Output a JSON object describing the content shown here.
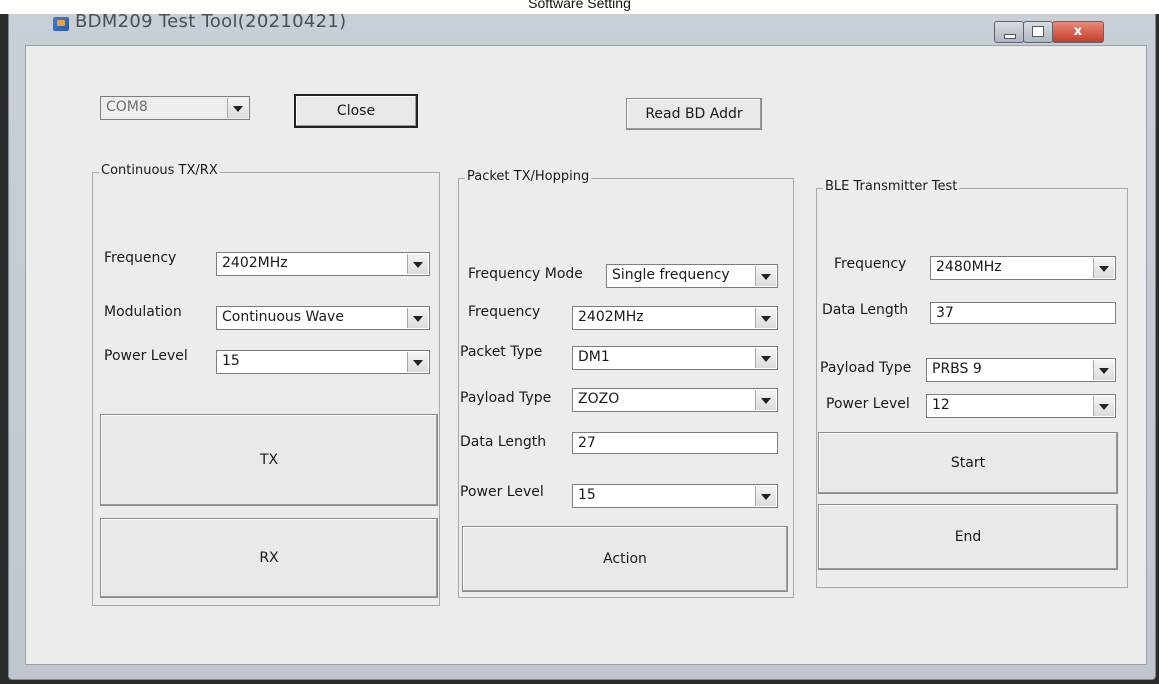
{
  "caption": "Software Setting",
  "window": {
    "title": "BDM209 Test Tool(20210421)",
    "close_glyph": "x"
  },
  "top": {
    "port": "COM8",
    "close_label": "Close",
    "read_addr_label": "Read BD Addr"
  },
  "continuous": {
    "title": "Continuous TX/RX",
    "frequency_label": "Frequency",
    "frequency_value": "2402MHz",
    "modulation_label": "Modulation",
    "modulation_value": "Continuous Wave",
    "power_label": "Power Level",
    "power_value": "15",
    "tx_label": "TX",
    "rx_label": "RX"
  },
  "packet": {
    "title": "Packet TX/Hopping",
    "freq_mode_label": "Frequency Mode",
    "freq_mode_value": "Single frequency",
    "frequency_label": "Frequency",
    "frequency_value": "2402MHz",
    "packet_type_label": "Packet Type",
    "packet_type_value": "DM1",
    "payload_type_label": "Payload Type",
    "payload_type_value": "ZOZO",
    "data_length_label": "Data Length",
    "data_length_value": "27",
    "power_label": "Power Level",
    "power_value": "15",
    "action_label": "Action"
  },
  "ble": {
    "title": "BLE Transmitter Test",
    "frequency_label": "Frequency",
    "frequency_value": "2480MHz",
    "data_length_label": "Data Length",
    "data_length_value": "37",
    "payload_type_label": "Payload Type",
    "payload_type_value": "PRBS 9",
    "power_label": "Power Level",
    "power_value": "12",
    "start_label": "Start",
    "end_label": "End"
  }
}
